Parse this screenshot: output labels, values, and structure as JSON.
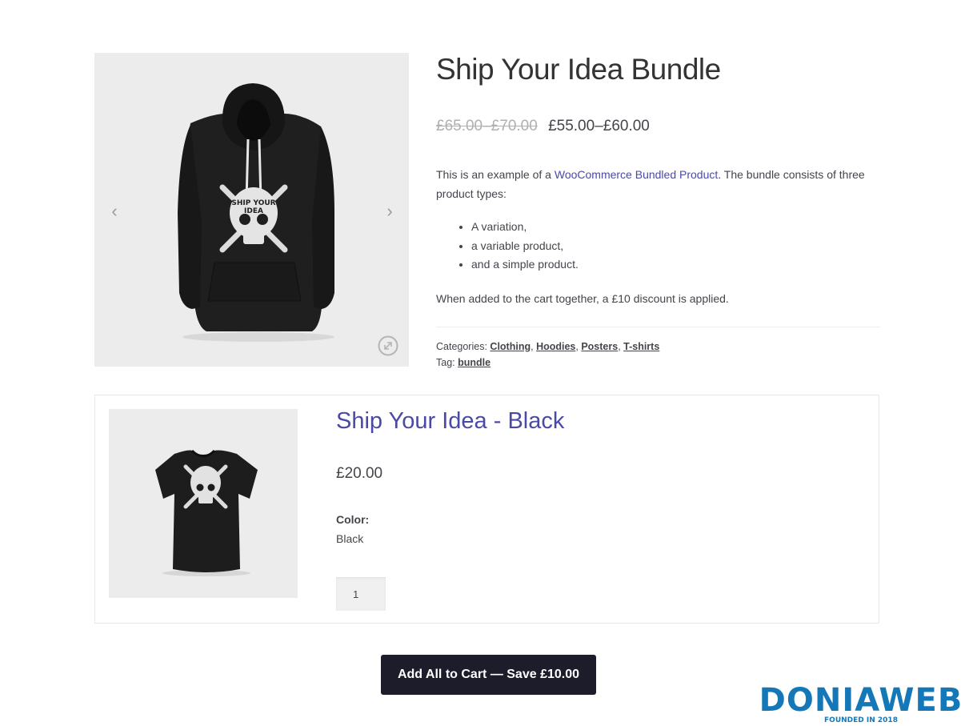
{
  "product": {
    "title": "Ship Your Idea Bundle",
    "price_old": "£65.00–£70.00",
    "price_new": "£55.00–£60.00",
    "description": {
      "intro_before_link": "This is an example of a ",
      "link_text": "WooCommerce Bundled Product",
      "intro_after_link": ". The bundle consists of three product types:",
      "list": [
        "A variation,",
        "a variable product,",
        "and a simple product."
      ],
      "outro": "When added to the cart together, a £10 discount is applied."
    },
    "meta": {
      "categories_label": "Categories:",
      "categories": [
        "Clothing",
        "Hoodies",
        "Posters",
        "T-shirts"
      ],
      "tag_label": "Tag:",
      "tag": "bundle"
    }
  },
  "gallery": {
    "prev_icon": "‹",
    "next_icon": "›",
    "hoodie_text": [
      "SHIP YOUR",
      "IDEA"
    ]
  },
  "bundled_item": {
    "title": "Ship Your Idea - Black",
    "price": "£20.00",
    "color_label": "Color:",
    "color_value": "Black",
    "quantity": "1"
  },
  "cart": {
    "button_label": "Add All to Cart — Save £10.00"
  },
  "watermark": {
    "brand": "DONIAWEB",
    "tagline": "FOUNDED IN 2018"
  },
  "colors": {
    "link": "#4a4aa4",
    "button_bg": "#1c1c2b",
    "image_bg": "#ececec",
    "logo": "#1478b8"
  }
}
